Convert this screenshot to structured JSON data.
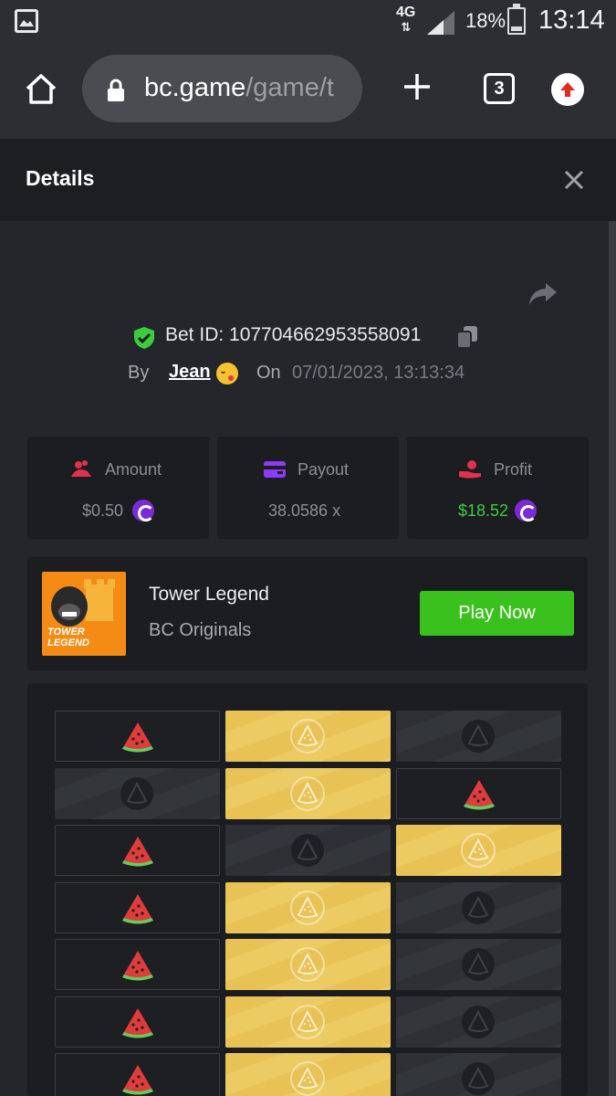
{
  "status_bar": {
    "network": "4G",
    "battery": "18%",
    "time": "13:14"
  },
  "browser": {
    "url_host": "bc.game",
    "url_path": "/game/t",
    "tab_count": "3"
  },
  "details": {
    "title": "Details",
    "bet_id": "Bet ID: 107704662953558091",
    "by_label": "By",
    "user": "Jean",
    "on_label": "On",
    "date": "07/01/2023, 13:13:34"
  },
  "stats": [
    {
      "label": "Amount",
      "value": "$0.50",
      "icon": "coins-icon",
      "color": "#e0314f"
    },
    {
      "label": "Payout",
      "value": "38.0586 x",
      "icon": "wallet-icon",
      "color": "#8b3cf7"
    },
    {
      "label": "Profit",
      "value": "$18.52",
      "icon": "hand-coin-icon",
      "color": "#e0314f",
      "value_color": "#3ccd3c"
    }
  ],
  "game": {
    "name": "Tower Legend",
    "provider": "BC Originals",
    "thumb_text_1": "TOWER",
    "thumb_text_2": "LEGEND",
    "play_label": "Play Now"
  },
  "board": {
    "rows": [
      [
        "red",
        "gold",
        "dark"
      ],
      [
        "dark",
        "gold",
        "red"
      ],
      [
        "red",
        "dark",
        "gold"
      ],
      [
        "red",
        "gold",
        "dark"
      ],
      [
        "red",
        "gold",
        "dark"
      ],
      [
        "red",
        "gold",
        "dark"
      ],
      [
        "red",
        "gold",
        "dark"
      ]
    ]
  },
  "colors": {
    "accent_green": "#3bc11d",
    "gold": "#e8c254",
    "coin_purple": "#7b2bd6"
  }
}
